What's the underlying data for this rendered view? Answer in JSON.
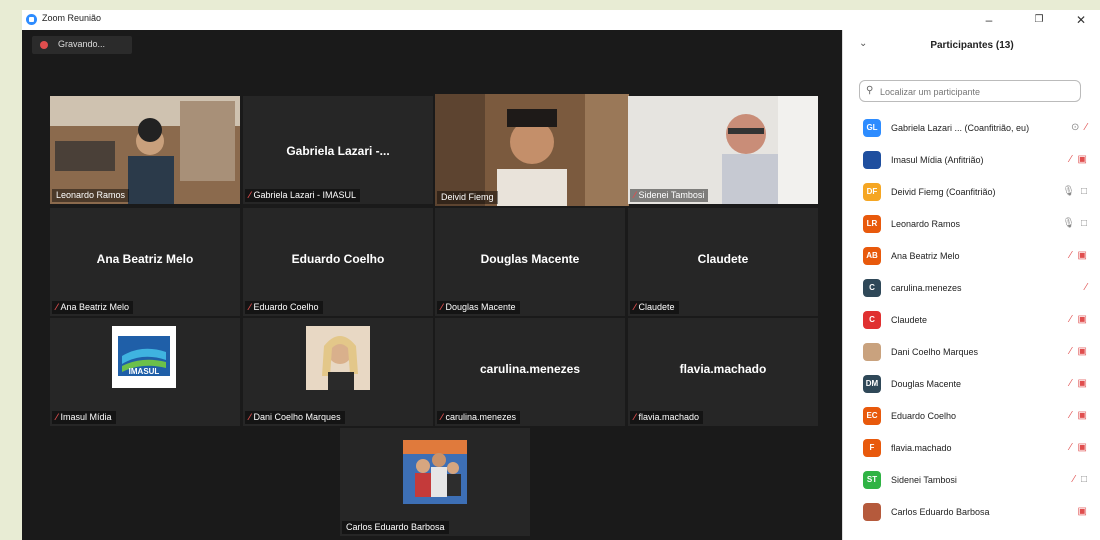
{
  "window": {
    "title": "Zoom Reunião"
  },
  "recording": {
    "label": "Gravando..."
  },
  "tiles": {
    "leonardo": {
      "label": "Leonardo Ramos"
    },
    "gabriela": {
      "center": "Gabriela Lazari -...",
      "label": "Gabriela Lazari - IMASUL"
    },
    "deivid": {
      "label": "Deivid Fiemg"
    },
    "sidenei": {
      "label": "Sidenei Tambosi"
    },
    "ana": {
      "center": "Ana Beatriz Melo",
      "label": "Ana Beatriz Melo"
    },
    "eduardo": {
      "center": "Eduardo Coelho",
      "label": "Eduardo Coelho"
    },
    "douglas": {
      "center": "Douglas Macente",
      "label": "Douglas Macente"
    },
    "claudete": {
      "center": "Claudete",
      "label": "Claudete"
    },
    "imasul": {
      "label": "Imasul Mídia",
      "logo_text": "IMASUL"
    },
    "dani": {
      "label": "Dani Coelho Marques"
    },
    "carulina": {
      "center": "carulina.menezes",
      "label": "carulina.menezes"
    },
    "flavia": {
      "center": "flavia.machado",
      "label": "flavia.machado"
    },
    "carlos": {
      "label": "Carlos Eduardo Barbosa"
    }
  },
  "panel": {
    "title": "Participantes (13)",
    "search_placeholder": "Localizar um participante",
    "participants": [
      {
        "initials": "GL",
        "name": "Gabriela Lazari ... (Coanfitrião, eu)",
        "color": "#2d8cff"
      },
      {
        "initials": "",
        "name": "Imasul Mídia (Anfitrião)",
        "color": "#1f4f9f"
      },
      {
        "initials": "DF",
        "name": "Deivid Fiemg (Coanfitrião)",
        "color": "#f5a623"
      },
      {
        "initials": "LR",
        "name": "Leonardo Ramos",
        "color": "#e8590c"
      },
      {
        "initials": "AB",
        "name": "Ana Beatriz Melo",
        "color": "#e8590c"
      },
      {
        "initials": "C",
        "name": "carulina.menezes",
        "color": "#2f4858"
      },
      {
        "initials": "C",
        "name": "Claudete",
        "color": "#e03131"
      },
      {
        "initials": "",
        "name": "Dani Coelho Marques",
        "color": "#c9a27e"
      },
      {
        "initials": "DM",
        "name": "Douglas Macente",
        "color": "#2f4858"
      },
      {
        "initials": "EC",
        "name": "Eduardo Coelho",
        "color": "#e8590c"
      },
      {
        "initials": "F",
        "name": "flavia.machado",
        "color": "#e8590c"
      },
      {
        "initials": "ST",
        "name": "Sidenei Tambosi",
        "color": "#2fb344"
      },
      {
        "initials": "",
        "name": "Carlos Eduardo Barbosa",
        "color": "#b55a3c"
      }
    ]
  }
}
